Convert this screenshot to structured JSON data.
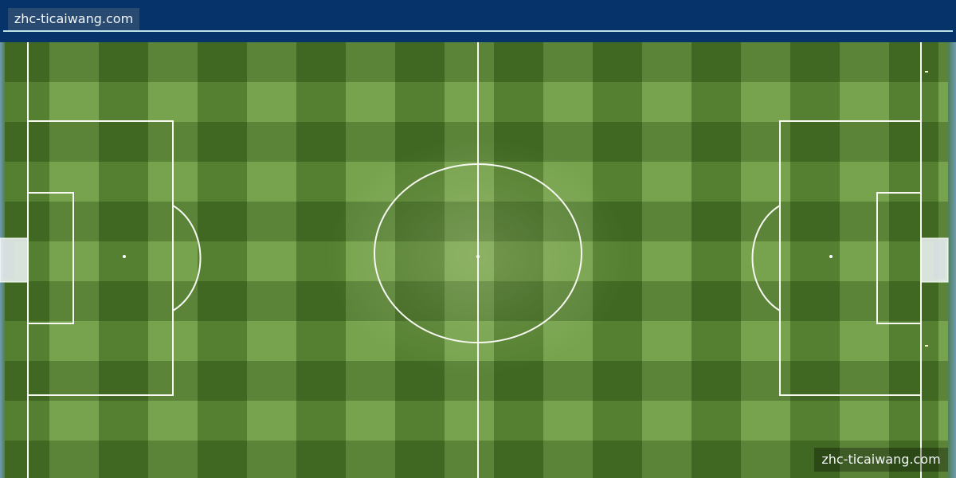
{
  "header": {
    "site_label": "zhc-ticaiwang.com"
  },
  "watermark": {
    "text": "zhc-ticaiwang.com"
  },
  "colors": {
    "header_bg": "#06346a",
    "grass_light": "#6c9b3f",
    "grass_dark": "#456f24",
    "line": "#ffffff",
    "edge_blue": "#5f8fa8"
  },
  "scene": {
    "subject": "aerial view of soccer pitch with striped grass",
    "stripe_direction": "checkerboard"
  }
}
